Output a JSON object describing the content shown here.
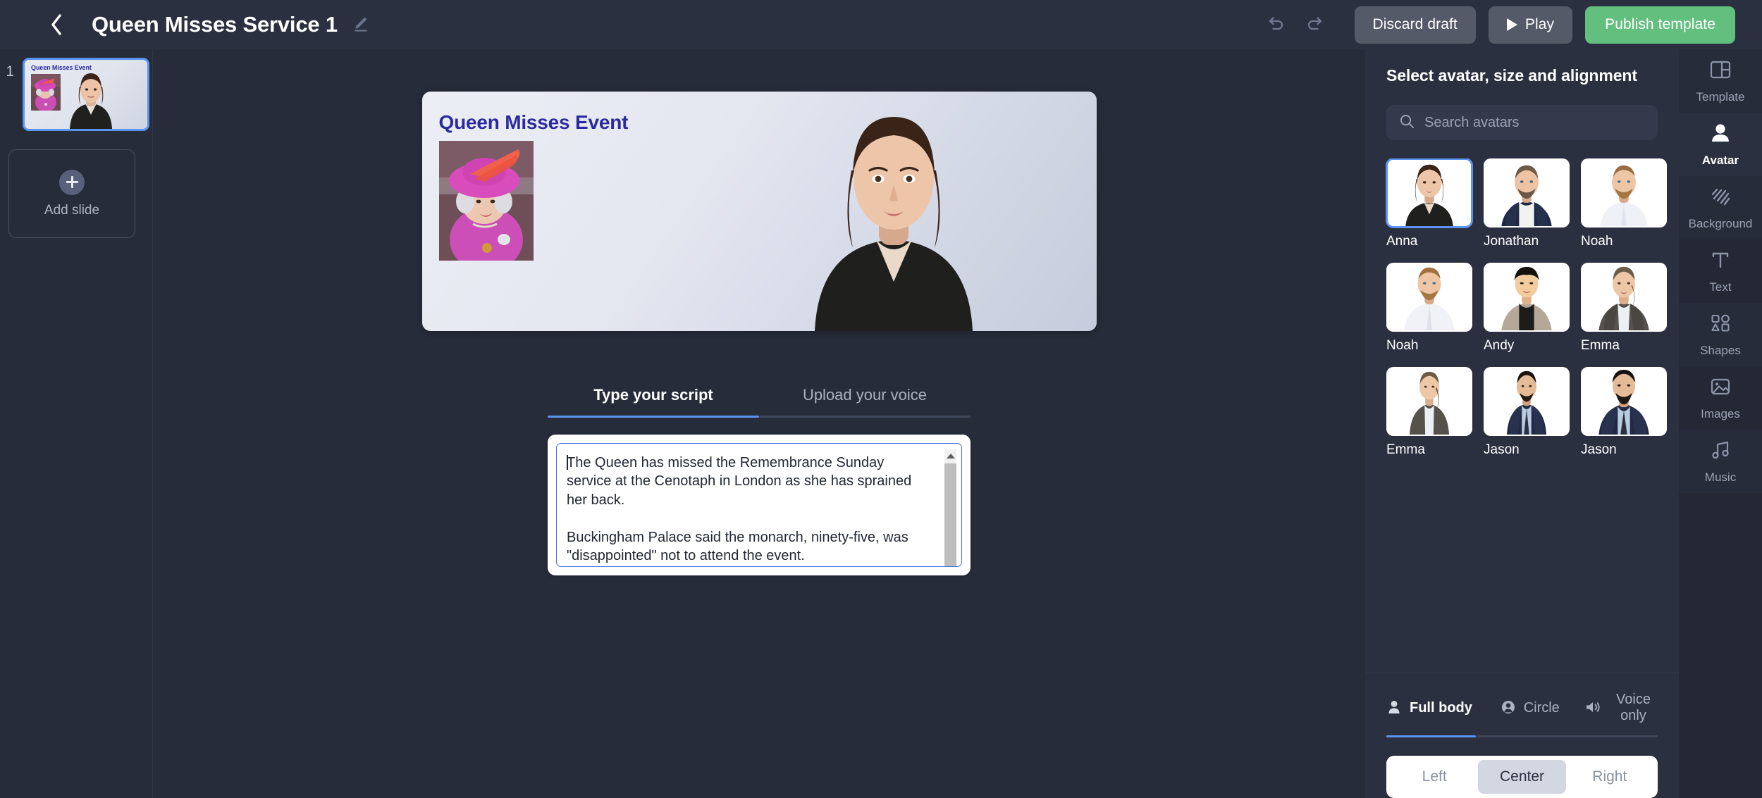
{
  "header": {
    "back_icon": "chevron-left-icon",
    "title": "Queen Misses Service 1",
    "edit_icon": "pencil-icon",
    "undo_icon": "undo-icon",
    "redo_icon": "redo-icon",
    "discard_label": "Discard draft",
    "play_label": "Play",
    "play_icon": "play-triangle-icon",
    "publish_label": "Publish template",
    "publish_color": "#63bf7e"
  },
  "slides": {
    "items": [
      {
        "number": "1",
        "title": "Queen Misses Event",
        "selected": true
      }
    ],
    "add_slide_label": "Add slide",
    "add_icon": "plus-icon"
  },
  "canvas": {
    "title": "Queen Misses Event",
    "title_color": "#2b2a9e",
    "photo_alt": "queen-photo",
    "avatar_alt": "avatar-anna"
  },
  "script": {
    "tabs": [
      {
        "label": "Type your script",
        "active": true
      },
      {
        "label": "Upload your voice",
        "active": false
      }
    ],
    "text": "The Queen has missed the Remembrance Sunday service at the Cenotaph in London as she has sprained her back.\n\nBuckingham Palace said the monarch, ninety-five, was \"disappointed\" not to attend the event."
  },
  "right_panel": {
    "title": "Select avatar, size and alignment",
    "search": {
      "placeholder": "Search avatars",
      "value": "",
      "icon": "search-icon"
    },
    "avatars": [
      {
        "name": "Anna",
        "selected": true
      },
      {
        "name": "Jonathan",
        "selected": false
      },
      {
        "name": "Noah",
        "selected": false
      },
      {
        "name": "Noah",
        "selected": false
      },
      {
        "name": "Andy",
        "selected": false
      },
      {
        "name": "Emma",
        "selected": false
      },
      {
        "name": "Emma",
        "selected": false
      },
      {
        "name": "Jason",
        "selected": false
      },
      {
        "name": "Jason",
        "selected": false
      }
    ],
    "modes": [
      {
        "label": "Full body",
        "icon": "person-icon",
        "active": true
      },
      {
        "label": "Circle",
        "icon": "circle-person-icon",
        "active": false
      },
      {
        "label": "Voice only",
        "icon": "speaker-icon",
        "active": false
      }
    ],
    "alignment": {
      "options": [
        "Left",
        "Center",
        "Right"
      ],
      "selected": "Center"
    },
    "accent_color": "#5b93f0"
  },
  "icon_rail": {
    "items": [
      {
        "label": "Template",
        "icon": "layout-icon",
        "active": false
      },
      {
        "label": "Avatar",
        "icon": "person-icon",
        "active": true
      },
      {
        "label": "Background",
        "icon": "hatching-icon",
        "active": false
      },
      {
        "label": "Text",
        "icon": "text-t-icon",
        "active": false
      },
      {
        "label": "Shapes",
        "icon": "shapes-icon",
        "active": false
      },
      {
        "label": "Images",
        "icon": "image-icon",
        "active": false
      },
      {
        "label": "Music",
        "icon": "music-note-icon",
        "active": false
      }
    ]
  }
}
